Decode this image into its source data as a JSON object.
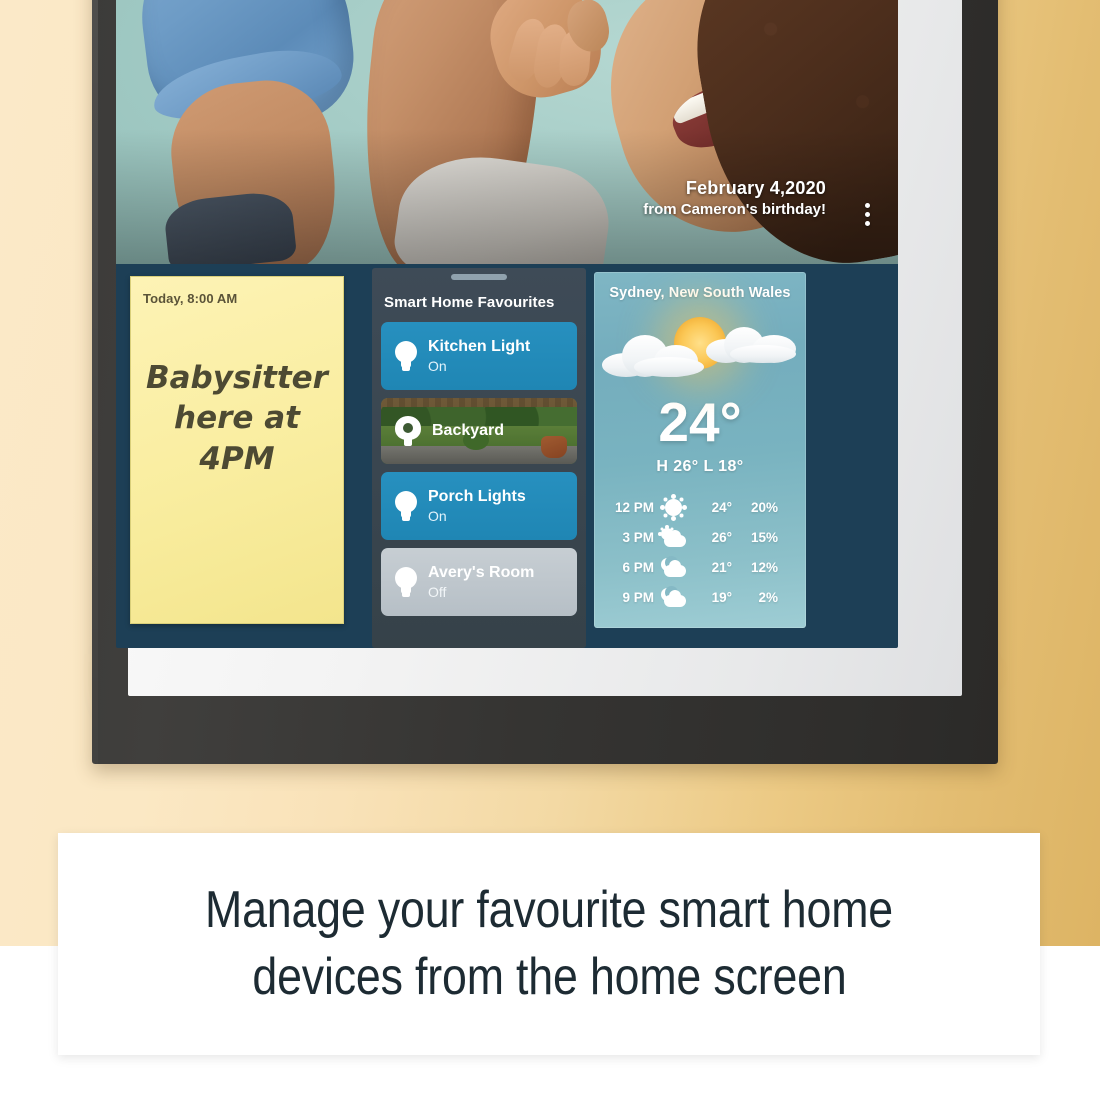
{
  "background": {
    "cream_hex": "#fbe9c8",
    "tan_hex": "#ddb464"
  },
  "device": {
    "frame_color": "#35342f",
    "inner_mat_color": "#f0f1f2",
    "screen_bg": "#1d3f56"
  },
  "photo": {
    "caption_line1": "February 4,2020",
    "caption_line2": "from Cameron's birthday!",
    "more_icon": "more-vertical-icon"
  },
  "note": {
    "time": "Today, 8:00 AM",
    "body": "Babysitter here at 4PM",
    "paper_hex": "#f9ed9f"
  },
  "smart_home": {
    "title": "Smart Home Favourites",
    "handle_icon": "drag-handle-icon",
    "cards": [
      {
        "name": "Kitchen Light",
        "state": "On",
        "icon": "lightbulb-icon",
        "style": "on",
        "accent": "#1f86b4"
      },
      {
        "name": "Backyard",
        "state": "",
        "icon": "camera-icon",
        "style": "cam",
        "accent": "#3d5a33"
      },
      {
        "name": "Porch Lights",
        "state": "On",
        "icon": "lightbulb-icon",
        "style": "on",
        "accent": "#1f86b4"
      },
      {
        "name": "Avery's Room",
        "state": "Off",
        "icon": "lightbulb-icon",
        "style": "off",
        "accent": "#b6bfc6"
      }
    ]
  },
  "weather": {
    "city": "Sydney, New South Wales",
    "current_temp": "24°",
    "high_low": "H 26°  L 18°",
    "condition_icon": "sun-behind-cloud-icon",
    "hours": [
      {
        "time": "12 PM",
        "icon": "sun-icon",
        "temp": "24°",
        "precip": "20%"
      },
      {
        "time": "3 PM",
        "icon": "partly-sunny-icon",
        "temp": "26°",
        "precip": "15%"
      },
      {
        "time": "6 PM",
        "icon": "partly-cloudy-night-icon",
        "temp": "21°",
        "precip": "12%"
      },
      {
        "time": "9 PM",
        "icon": "partly-cloudy-night-icon",
        "temp": "19°",
        "precip": "2%"
      }
    ]
  },
  "caption": {
    "line1": "Manage your favourite smart home",
    "line2": "devices from the home screen"
  }
}
